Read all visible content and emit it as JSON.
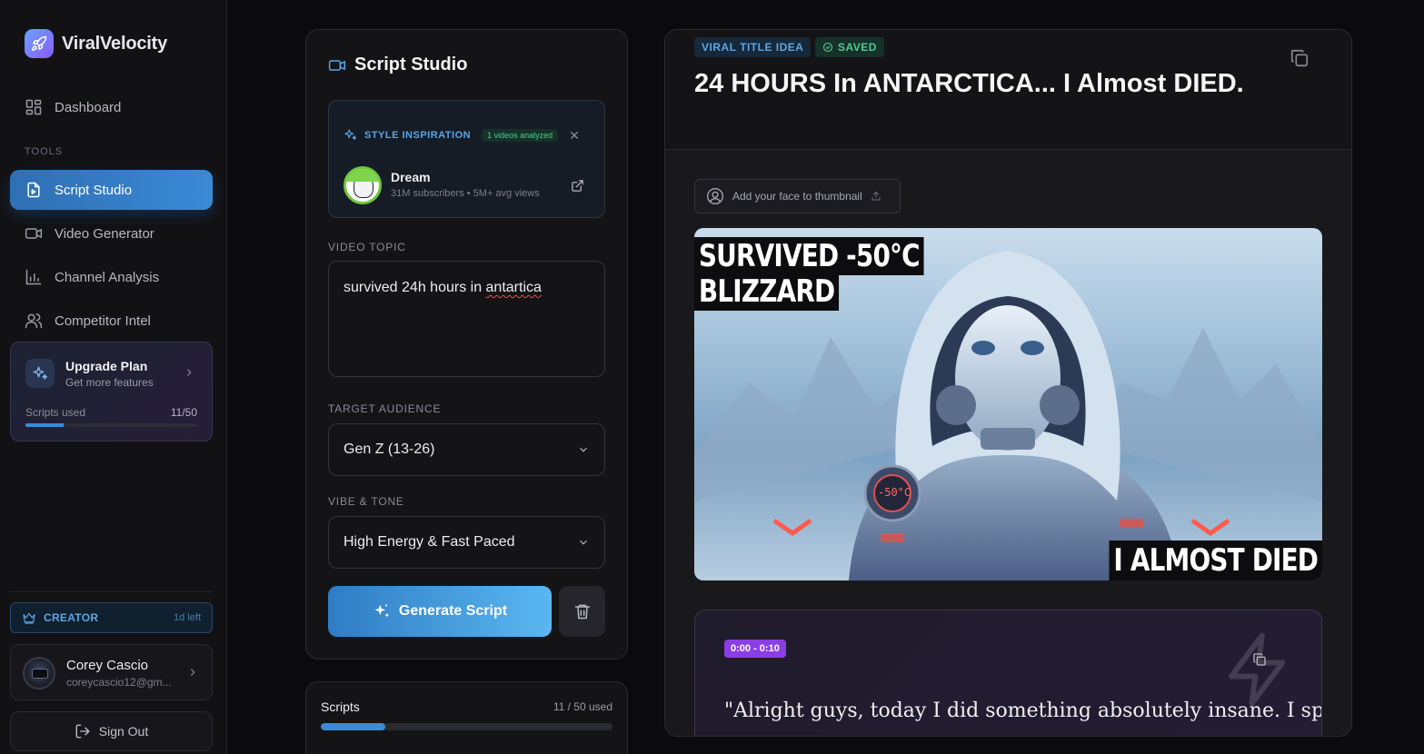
{
  "app": {
    "name": "ViralVelocity"
  },
  "sidebar": {
    "dashboard": "Dashboard",
    "tools_label": "TOOLS",
    "items": [
      {
        "label": "Script Studio",
        "icon": "file-icon",
        "active": true
      },
      {
        "label": "Video Generator",
        "icon": "video-icon",
        "active": false
      },
      {
        "label": "Channel Analysis",
        "icon": "chart-icon",
        "active": false
      },
      {
        "label": "Competitor Intel",
        "icon": "users-icon",
        "active": false
      }
    ],
    "upgrade": {
      "title": "Upgrade Plan",
      "subtitle": "Get more features",
      "used_label": "Scripts used",
      "used_count": "11/50",
      "progress": 0.22
    },
    "plan": {
      "name": "CREATOR",
      "time_left": "1d left"
    },
    "user": {
      "name": "Corey Cascio",
      "email": "coreycascio12@gm..."
    },
    "sign_out": "Sign Out"
  },
  "studio": {
    "title": "Script Studio",
    "style_inspiration": {
      "label": "STYLE INSPIRATION",
      "badge": "1 videos analyzed",
      "creator_name": "Dream",
      "creator_meta": "31M subscribers • 5M+ avg views"
    },
    "video_topic": {
      "label": "VIDEO TOPIC",
      "value_prefix": "survived 24h hours in ",
      "value_misspelled": "antartica"
    },
    "target_audience": {
      "label": "TARGET AUDIENCE",
      "value": "Gen Z (13-26)"
    },
    "vibe_tone": {
      "label": "VIBE & TONE",
      "value": "High Energy & Fast Paced"
    },
    "generate_label": "Generate Script",
    "scripts": {
      "title": "Scripts",
      "count": "11 / 50 used",
      "progress": 0.22
    }
  },
  "result": {
    "badge_idea": "VIRAL TITLE IDEA",
    "badge_saved": "SAVED",
    "title": "24 HOURS In ANTARCTICA... I Almost DIED.",
    "face_button": "Add your face to thumbnail",
    "thumbnail": {
      "caption_line1": "SURVIVED -50°C",
      "caption_line2": "BLIZZARD",
      "caption_bottom": "I ALMOST DIED",
      "chest_readout": "-50°C"
    },
    "segment": {
      "time": "0:00 - 0:10",
      "text": "\"Alright guys, today I did something absolutely insane. I spent"
    }
  },
  "colors": {
    "accent": "#3a8ad6",
    "success": "#4ecb8f",
    "purple": "#8b3ee6",
    "background": "#0b0b0d"
  }
}
